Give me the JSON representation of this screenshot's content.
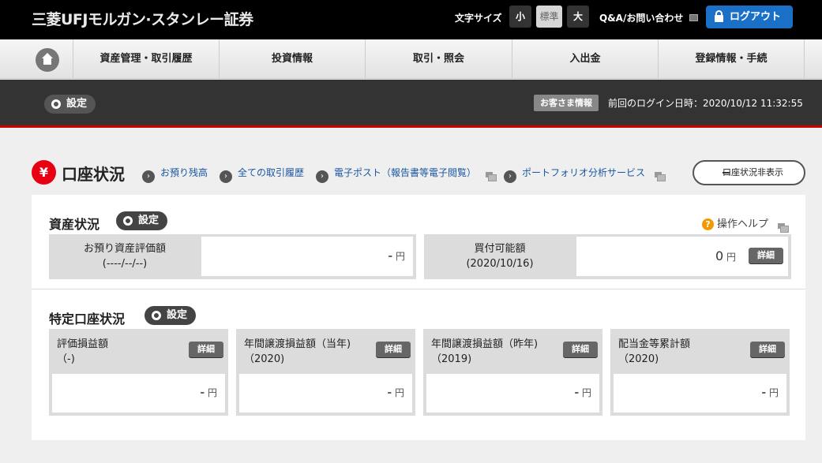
{
  "header": {
    "logo": "三菱UFJモルガン·スタンレー証券",
    "font_size_label": "文字サイズ",
    "font_sizes": [
      "小",
      "標準",
      "大"
    ],
    "selected_font_size": "標準",
    "qa_label": "Q&A/お問い合わせ",
    "logout_label": "ログアウト"
  },
  "nav": {
    "items": [
      "資産管理・取引履歴",
      "投資情報",
      "取引・照会",
      "入出金",
      "登録情報・手続"
    ]
  },
  "subbar": {
    "settings_label": "設定",
    "customer_info_label": "お客さま情報",
    "last_login_label": "前回のログイン日時：2020/10/12 11:32:55"
  },
  "account": {
    "title": "口座状況",
    "yen_symbol": "¥",
    "links": [
      "お預り残高",
      "全ての取引履歴",
      "電子ポスト（報告書等電子閲覧）",
      "ポートフォリオ分析サービス"
    ],
    "hide_label": "口座状況非表示"
  },
  "assets": {
    "title": "資産状況",
    "settings_label": "設定",
    "help_label": "操作ヘルプ",
    "eval_label_1": "お預り資産評価額",
    "eval_label_2": "(----/--/--)",
    "eval_value": "-",
    "buy_label_1": "買付可能額",
    "buy_label_2": "(2020/10/16)",
    "buy_value": "0",
    "yen_unit": "円",
    "detail_label": "詳細"
  },
  "specific": {
    "title": "特定口座状況",
    "settings_label": "設定",
    "cards": [
      {
        "label1": "評価損益額",
        "label2": "（-)",
        "value": "-"
      },
      {
        "label1": "年間譲渡損益額（当年)",
        "label2": "（2020)",
        "value": "-"
      },
      {
        "label1": "年間譲渡損益額（昨年)",
        "label2": "（2019)",
        "value": "-"
      },
      {
        "label1": "配当金等累計額",
        "label2": "（2020)",
        "value": "-"
      }
    ],
    "yen_unit": "円",
    "detail_label": "詳細"
  },
  "colors": {
    "accent_red": "#e60012",
    "logout_blue": "#1a6fc7",
    "link_blue": "#1a56a0",
    "help_orange": "#f39800"
  }
}
